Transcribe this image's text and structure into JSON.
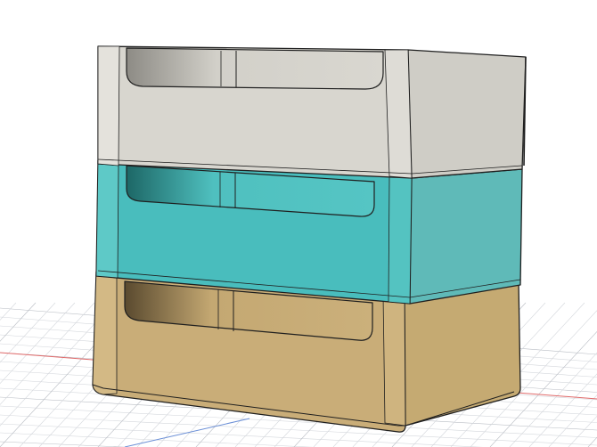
{
  "viewport": {
    "background": "#ffffff"
  },
  "grid": {
    "line_color": "#d4d7dc",
    "major_line_color": "#b9bdc4",
    "x_axis_color": "#e06a6a",
    "y_axis_color": "#6b8fd6"
  },
  "model": {
    "outline_color": "#1f1f1f",
    "crates": [
      {
        "name": "top-crate",
        "front": "#d8d6cf",
        "side": "#cfcdc6",
        "rim": "#e4e2dc",
        "hole_dark": "#8d8b85",
        "hole_light": "#d2d0c9"
      },
      {
        "name": "middle-crate",
        "front": "#49bdbd",
        "side": "#5fbab8",
        "rim": "#5ec9c7",
        "hole_dark": "#1d6766",
        "hole_light": "#4fc0bf"
      },
      {
        "name": "bottom-crate",
        "front": "#c9ad78",
        "side": "#c5aa72",
        "rim": "#d3b985",
        "hole_dark": "#5a4a2f",
        "hole_light": "#c4a872"
      }
    ]
  }
}
